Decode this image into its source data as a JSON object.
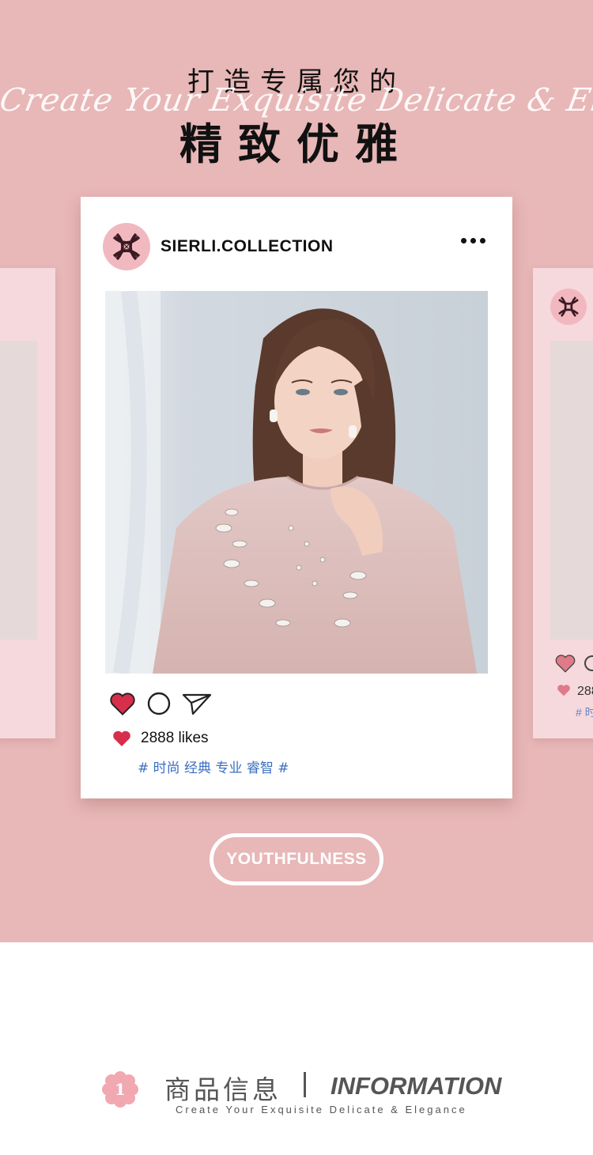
{
  "hero": {
    "title_line1": "打造专属您的",
    "script_text": "Create Your Exquisite Delicate & Elegance",
    "title_line2": "精致优雅"
  },
  "post": {
    "username": "SIERLI.COLLECTION",
    "likes": "2888 likes",
    "tags": "# 时尚 经典 专业 睿智 #",
    "icons": [
      "heart-icon",
      "comment-icon",
      "share-icon",
      "more-icon"
    ]
  },
  "side_card_right": {
    "likes_partial": "288",
    "tag_partial": "# 时"
  },
  "pill": {
    "label": "YOUTHFULNESS"
  },
  "info": {
    "number": "1",
    "cn_title": "商品信息",
    "en_title": "INFORMATION",
    "subtitle": "Create Your Exquisite Delicate & Elegance"
  },
  "colors": {
    "background_pink": "#e8b7b7",
    "avatar_pink": "#f2b8c0",
    "heart_red": "#d72e4b",
    "tag_blue": "#3a6fc1"
  }
}
